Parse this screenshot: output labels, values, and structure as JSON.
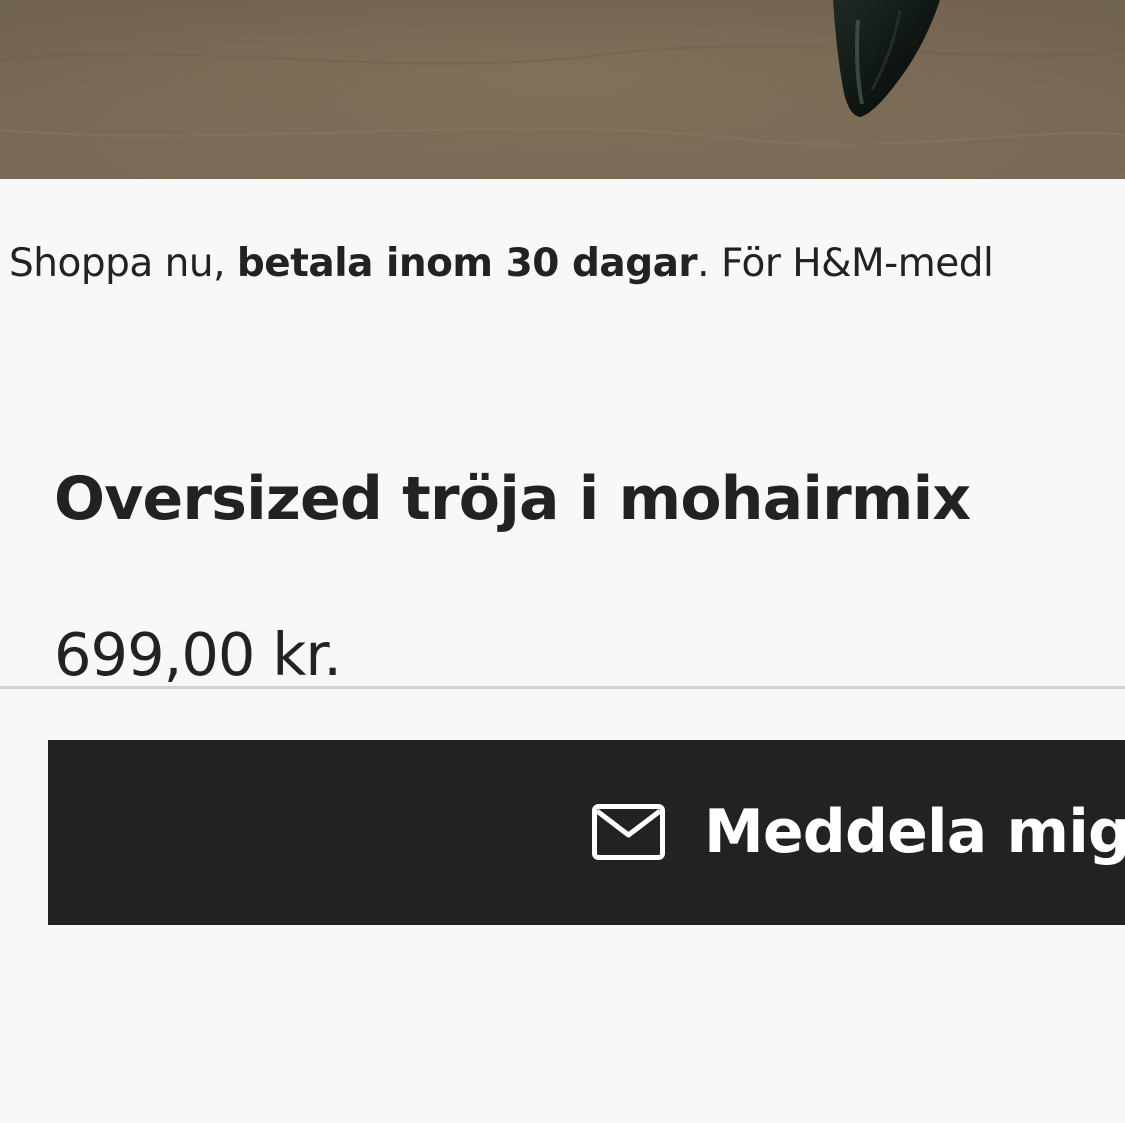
{
  "hero": {
    "image": "product-photo-cropped"
  },
  "promo": {
    "text_before": "Shoppa nu, ",
    "text_bold": "betala inom 30 dagar",
    "text_after": ". För H&M-medl"
  },
  "product": {
    "title": "Oversized tröja i mohairmix",
    "price": "699,00 kr."
  },
  "cta": {
    "label": "Meddela mig",
    "icon": "envelope-icon"
  },
  "colors": {
    "background": "#f9f8f6",
    "text": "#222222",
    "button": "#222222",
    "button_text": "#ffffff",
    "divider": "#d3d2d0"
  }
}
